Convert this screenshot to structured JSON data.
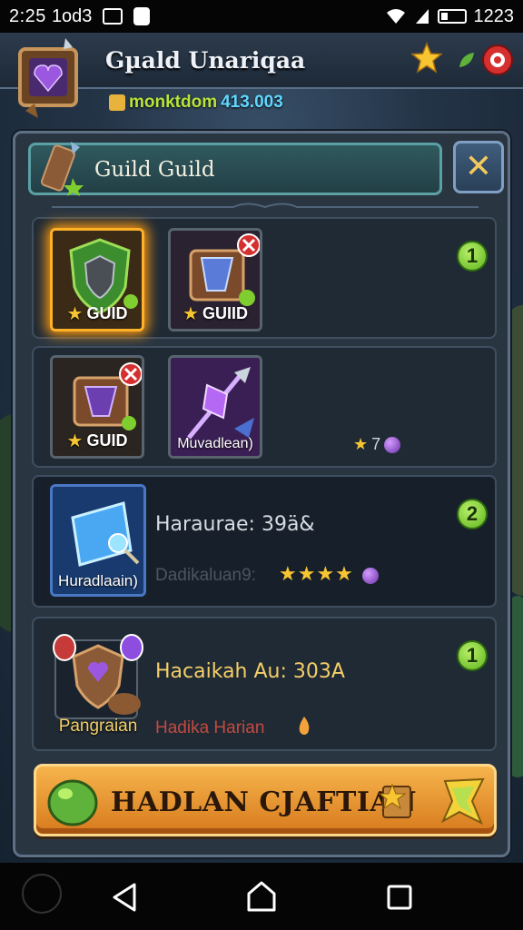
{
  "status_bar": {
    "time": "2:25",
    "carrier_text": "1od3",
    "clock_right": "1223",
    "icons": [
      "image-icon",
      "notification-icon",
      "wifi-icon",
      "signal-icon",
      "battery-icon"
    ]
  },
  "header": {
    "title": "Gµald Unariqaa",
    "sub_label": "monktdom",
    "sub_value": "413.003"
  },
  "panel": {
    "title": "Guild Guild",
    "close_label": "✕",
    "sections": [
      {
        "slots": [
          {
            "caption": "GUID",
            "star": "★",
            "icon": "shield-emblem-icon"
          },
          {
            "caption": "GUIID",
            "star": "★",
            "icon": "treasure-chest-icon"
          }
        ],
        "badge": "1"
      },
      {
        "slots": [
          {
            "caption": "GUID",
            "star": "★",
            "icon": "treasure-chest-icon"
          },
          {
            "caption": "Muvadlean)",
            "icon": "magic-staff-icon"
          }
        ],
        "reward_text": "7",
        "reward_star": "★"
      },
      {
        "slot_caption": "Huradlaain)",
        "main_text": "Haraurae: 39ä&",
        "faded_text": "Dadikaluan9:",
        "stars": "★★★★",
        "badge": "2"
      },
      {
        "slot_caption": "Pangraian",
        "main_text": "Hacaikah Au: 303A",
        "red_text": "Hadika Harian",
        "badge": "1"
      }
    ],
    "action_button": "HADLAN CJAFTIAN"
  },
  "colors": {
    "accent_gold": "#f7c531",
    "badge_green": "#7fce2f",
    "button_orange": "#e99a34",
    "panel_bg": "#2a3542"
  }
}
